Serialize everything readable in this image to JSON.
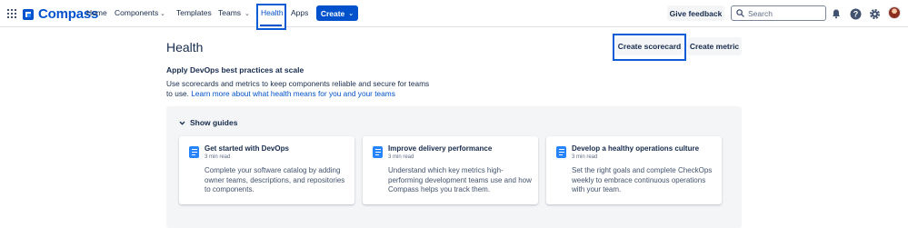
{
  "nav": {
    "logo_text": "Compass",
    "items": [
      {
        "label": "Home"
      },
      {
        "label": "Components",
        "dropdown": true
      },
      {
        "label": "Templates"
      },
      {
        "label": "Teams",
        "dropdown": true
      },
      {
        "label": "Health",
        "active": true
      },
      {
        "label": "Apps"
      }
    ],
    "create_label": "Create",
    "feedback_label": "Give feedback",
    "search_placeholder": "Search",
    "icons": [
      "notifications-icon",
      "help-icon",
      "settings-icon"
    ]
  },
  "header": {
    "title": "Health",
    "create_scorecard_label": "Create scorecard",
    "create_metric_label": "Create metric"
  },
  "intro": {
    "heading": "Apply DevOps best practices at scale",
    "text": "Use scorecards and metrics to keep components reliable and secure for teams to use.",
    "link": "Learn more about what health means for you and your teams"
  },
  "guides": {
    "toggle_label": "Show guides",
    "cards": [
      {
        "title": "Get started with DevOps",
        "meta": "3 min read",
        "body": "Complete your software catalog by adding owner teams, descriptions, and repositories to components."
      },
      {
        "title": "Improve delivery performance",
        "meta": "3 min read",
        "body": "Understand which key metrics high-performing development teams use and how Compass helps you track them."
      },
      {
        "title": "Develop a healthy operations culture",
        "meta": "3 min read",
        "body": "Set the right goals and complete CheckOps weekly to embrace continuous operations with your team."
      }
    ]
  },
  "colors": {
    "brand": "#0052CC",
    "highlight_box": "#0B5CD5",
    "panel_bg": "#F4F5F7",
    "icon_blue": "#2684FF"
  }
}
